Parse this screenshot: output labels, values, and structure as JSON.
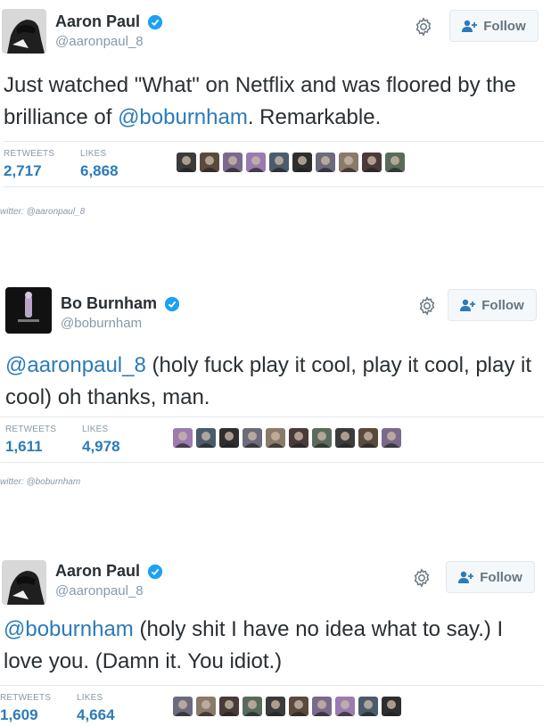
{
  "colors": {
    "link": "#2b7bb9",
    "muted": "#8899a6",
    "text": "#292f33",
    "verified": "#1da1f2",
    "border": "#e1e8ed"
  },
  "tweets": [
    {
      "display_name": "Aaron Paul",
      "handle": "@aaronpaul_8",
      "follow_label": "Follow",
      "text_before": "Just watched \"What\" on Netflix and was floored by the brilliance of ",
      "mention": "@boburnham",
      "text_after": ". Remarkable.",
      "retweets_label": "RETWEETS",
      "retweets": "2,717",
      "likes_label": "LIKES",
      "likes": "6,868",
      "source": "witter: @aaronpaul_8",
      "liker_count": 10
    },
    {
      "display_name": "Bo Burnham",
      "handle": "@boburnham",
      "follow_label": "Follow",
      "mention": "@aaronpaul_8",
      "text_after": " (holy fuck play it cool, play it cool, play it cool) oh thanks, man.",
      "retweets_label": "RETWEETS",
      "retweets": "1,611",
      "likes_label": "LIKES",
      "likes": "4,978",
      "source": "witter: @boburnham",
      "liker_count": 10
    },
    {
      "display_name": "Aaron Paul",
      "handle": "@aaronpaul_8",
      "follow_label": "Follow",
      "mention": "@boburnham",
      "text_after": " (holy shit I have no idea what to say.) I love you. (Damn it. You idiot.)",
      "retweets_label": "RETWEETS",
      "retweets": "1,609",
      "likes_label": "LIKES",
      "likes": "4,664",
      "liker_count": 10
    }
  ]
}
